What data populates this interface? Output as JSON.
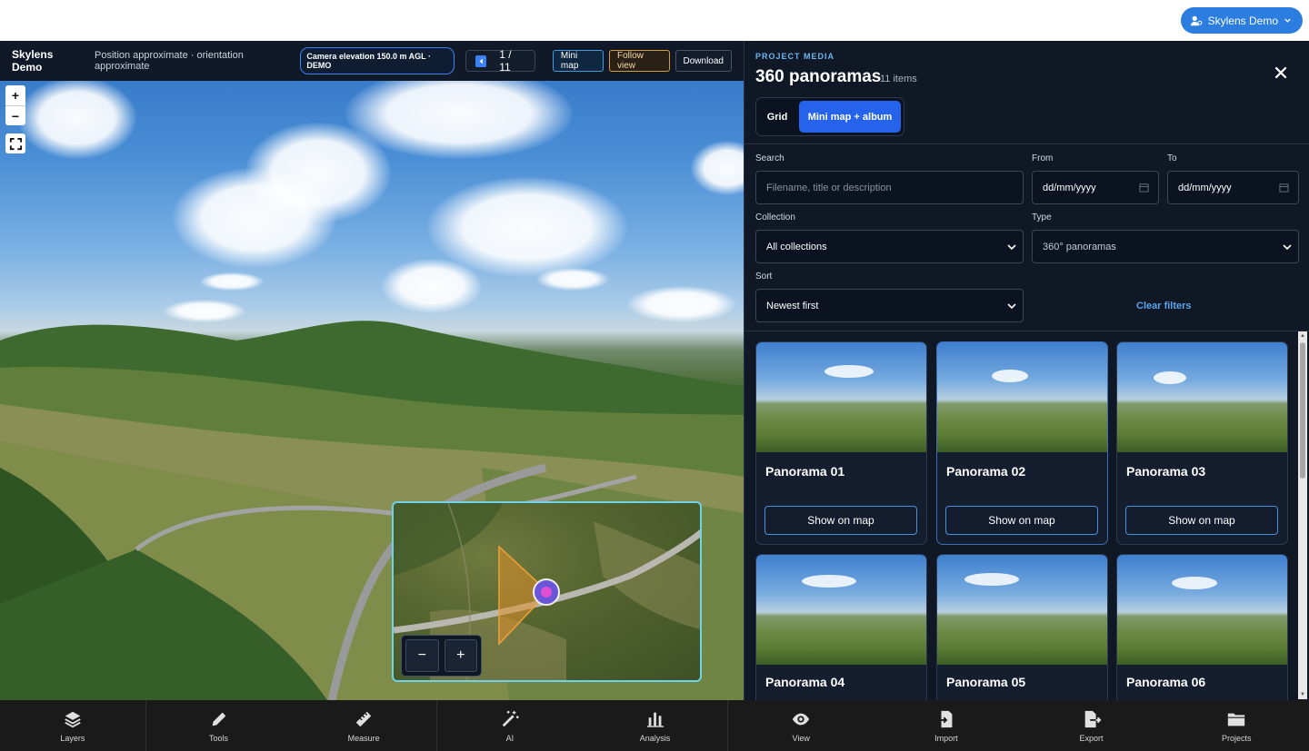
{
  "topbar": {
    "user_label": "Skylens Demo"
  },
  "viewer": {
    "title": "Skylens Demo",
    "approx": "Position approximate · orientation approximate",
    "elevation": "Camera elevation 150.0 m AGL · DEMO",
    "counter": "1 / 11",
    "btn_minimap": "Mini map",
    "btn_follow": "Follow view",
    "btn_download": "Download",
    "zoom_in": "+",
    "zoom_out": "−",
    "minimap_zoom_out": "−",
    "minimap_zoom_in": "+"
  },
  "panel": {
    "eyebrow": "PROJECT MEDIA",
    "title": "360 panoramas",
    "count": "11 items",
    "view_grid": "Grid",
    "view_album": "Mini map + album",
    "search_label": "Search",
    "search_placeholder": "Filename, title or description",
    "from_label": "From",
    "from_placeholder": "dd/mm/yyyy",
    "to_label": "To",
    "to_placeholder": "dd/mm/yyyy",
    "collection_label": "Collection",
    "collection_value": "All collections",
    "type_label": "Type",
    "type_value": "360° panoramas",
    "sort_label": "Sort",
    "sort_value": "Newest first",
    "clear_filters": "Clear filters",
    "show_on_map": "Show on map",
    "cards": [
      {
        "name": "Panorama 01"
      },
      {
        "name": "Panorama 02"
      },
      {
        "name": "Panorama 03"
      },
      {
        "name": "Panorama 04"
      },
      {
        "name": "Panorama 05"
      },
      {
        "name": "Panorama 06"
      }
    ]
  },
  "toolbar": {
    "items": [
      {
        "label": "Layers",
        "icon": "layers-icon"
      },
      {
        "label": "Tools",
        "icon": "pencil-icon"
      },
      {
        "label": "Measure",
        "icon": "ruler-icon"
      },
      {
        "label": "AI",
        "icon": "magic-wand-icon"
      },
      {
        "label": "Analysis",
        "icon": "bar-chart-icon"
      },
      {
        "label": "View",
        "icon": "eye-icon"
      },
      {
        "label": "Import",
        "icon": "import-icon"
      },
      {
        "label": "Export",
        "icon": "export-icon"
      },
      {
        "label": "Projects",
        "icon": "folder-icon"
      }
    ]
  },
  "colors": {
    "accent": "#2563eb",
    "link": "#58a6ee",
    "minimap_border": "#6fd2e8",
    "follow": "#d99a3a"
  }
}
